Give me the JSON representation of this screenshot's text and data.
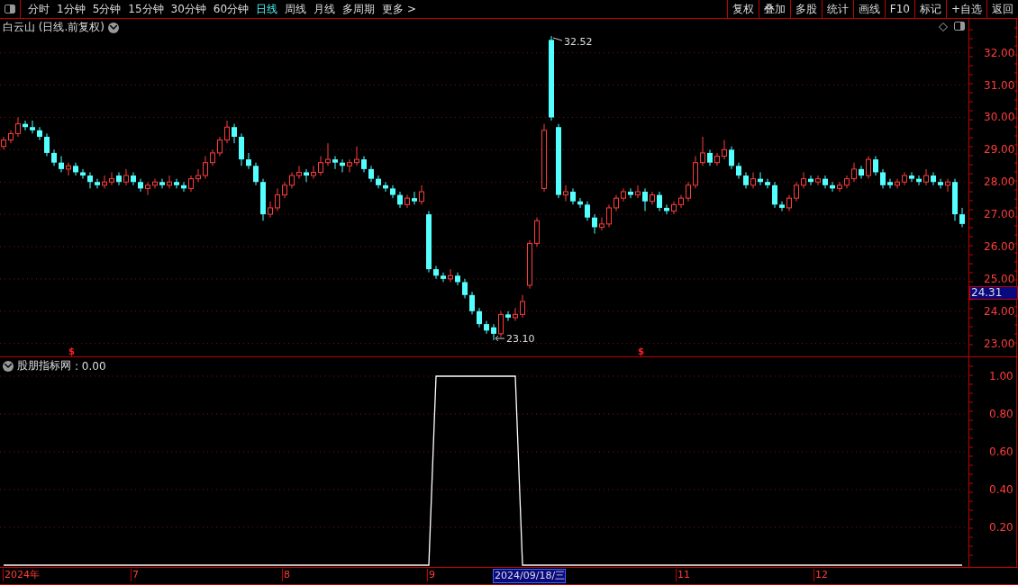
{
  "toolbar": {
    "periods": [
      {
        "label": "分时",
        "selected": false
      },
      {
        "label": "1分钟",
        "selected": false
      },
      {
        "label": "5分钟",
        "selected": false
      },
      {
        "label": "15分钟",
        "selected": false
      },
      {
        "label": "30分钟",
        "selected": false
      },
      {
        "label": "60分钟",
        "selected": false
      },
      {
        "label": "日线",
        "selected": true
      },
      {
        "label": "周线",
        "selected": false
      },
      {
        "label": "月线",
        "selected": false
      },
      {
        "label": "多周期",
        "selected": false
      },
      {
        "label": "更多 >",
        "selected": false
      }
    ],
    "actions": [
      "复权",
      "叠加",
      "多股",
      "统计",
      "画线",
      "F10",
      "标记",
      "+自选",
      "返回"
    ]
  },
  "main_chart": {
    "title": "白云山 (日线.前复权)",
    "current_price": "24.31",
    "markers": [
      "$",
      "$"
    ],
    "chart_data": {
      "type": "candlestick",
      "ylim": [
        22.6,
        33.05
      ],
      "yticks": [
        {
          "value": 32,
          "label": "32.00"
        },
        {
          "value": 31,
          "label": "31.00"
        },
        {
          "value": 30,
          "label": "30.00"
        },
        {
          "value": 29,
          "label": "29.00"
        },
        {
          "value": 28,
          "label": "28.00"
        },
        {
          "value": 27,
          "label": "27.00"
        },
        {
          "value": 26,
          "label": "26.00"
        },
        {
          "value": 25,
          "label": "25.00"
        },
        {
          "value": 24,
          "label": "24.00"
        },
        {
          "value": 23,
          "label": "23.00"
        }
      ],
      "grid": true,
      "annotations": [
        "32.52",
        "23.10"
      ],
      "ohlc": [
        [
          29.1,
          29.4,
          29.0,
          29.3
        ],
        [
          29.3,
          29.6,
          29.2,
          29.5
        ],
        [
          29.5,
          30.0,
          29.4,
          29.8
        ],
        [
          29.8,
          29.9,
          29.6,
          29.7
        ],
        [
          29.7,
          29.9,
          29.5,
          29.6
        ],
        [
          29.6,
          29.7,
          29.3,
          29.4
        ],
        [
          29.4,
          29.5,
          28.8,
          28.9
        ],
        [
          28.9,
          29.0,
          28.5,
          28.6
        ],
        [
          28.6,
          28.8,
          28.3,
          28.4
        ],
        [
          28.4,
          28.6,
          28.2,
          28.5
        ],
        [
          28.5,
          28.6,
          28.2,
          28.3
        ],
        [
          28.3,
          28.4,
          28.1,
          28.2
        ],
        [
          28.2,
          28.3,
          27.8,
          28.0
        ],
        [
          28.0,
          28.1,
          27.8,
          27.9
        ],
        [
          27.9,
          28.2,
          27.8,
          28.0
        ],
        [
          28.0,
          28.3,
          27.9,
          28.1
        ],
        [
          28.2,
          28.3,
          27.9,
          28.0
        ],
        [
          28.0,
          28.4,
          27.9,
          28.2
        ],
        [
          28.2,
          28.3,
          27.9,
          28.0
        ],
        [
          28.0,
          28.1,
          27.7,
          27.8
        ],
        [
          27.8,
          28.0,
          27.6,
          27.9
        ],
        [
          27.9,
          28.1,
          27.8,
          28.0
        ],
        [
          28.0,
          28.1,
          27.8,
          27.9
        ],
        [
          27.9,
          28.2,
          27.8,
          28.0
        ],
        [
          28.0,
          28.1,
          27.8,
          27.9
        ],
        [
          27.9,
          28.0,
          27.7,
          27.8
        ],
        [
          27.8,
          28.2,
          27.7,
          28.1
        ],
        [
          28.1,
          28.4,
          28.0,
          28.2
        ],
        [
          28.2,
          28.8,
          28.1,
          28.6
        ],
        [
          28.6,
          29.0,
          28.5,
          28.9
        ],
        [
          28.9,
          29.4,
          28.8,
          29.3
        ],
        [
          29.3,
          29.9,
          29.2,
          29.7
        ],
        [
          29.7,
          29.8,
          29.2,
          29.4
        ],
        [
          29.4,
          29.5,
          28.5,
          28.7
        ],
        [
          28.7,
          28.9,
          28.4,
          28.5
        ],
        [
          28.5,
          28.6,
          27.9,
          28.0
        ],
        [
          28.0,
          28.1,
          26.8,
          27.0
        ],
        [
          27.0,
          27.4,
          26.9,
          27.2
        ],
        [
          27.2,
          27.8,
          27.1,
          27.6
        ],
        [
          27.6,
          28.0,
          27.5,
          27.9
        ],
        [
          27.9,
          28.3,
          27.8,
          28.2
        ],
        [
          28.2,
          28.5,
          28.1,
          28.3
        ],
        [
          28.3,
          28.4,
          28.0,
          28.2
        ],
        [
          28.2,
          28.5,
          28.1,
          28.3
        ],
        [
          28.3,
          28.8,
          28.2,
          28.6
        ],
        [
          28.6,
          29.2,
          28.5,
          28.7
        ],
        [
          28.7,
          28.8,
          28.4,
          28.6
        ],
        [
          28.6,
          28.7,
          28.3,
          28.5
        ],
        [
          28.5,
          28.7,
          28.3,
          28.6
        ],
        [
          28.6,
          29.1,
          28.5,
          28.7
        ],
        [
          28.7,
          28.8,
          28.3,
          28.4
        ],
        [
          28.4,
          28.5,
          28.0,
          28.1
        ],
        [
          28.1,
          28.2,
          27.8,
          27.9
        ],
        [
          27.9,
          28.0,
          27.7,
          27.8
        ],
        [
          27.8,
          27.9,
          27.5,
          27.6
        ],
        [
          27.6,
          27.7,
          27.2,
          27.3
        ],
        [
          27.3,
          27.6,
          27.2,
          27.5
        ],
        [
          27.5,
          27.7,
          27.3,
          27.4
        ],
        [
          27.4,
          27.9,
          27.3,
          27.7
        ],
        [
          27.0,
          27.1,
          25.2,
          25.3
        ],
        [
          25.3,
          25.4,
          25.0,
          25.1
        ],
        [
          25.1,
          25.2,
          24.9,
          25.0
        ],
        [
          25.0,
          25.3,
          24.9,
          25.1
        ],
        [
          25.1,
          25.2,
          24.8,
          24.9
        ],
        [
          24.9,
          25.0,
          24.4,
          24.5
        ],
        [
          24.5,
          24.6,
          23.9,
          24.0
        ],
        [
          24.0,
          24.1,
          23.5,
          23.6
        ],
        [
          23.6,
          23.7,
          23.3,
          23.4
        ],
        [
          23.5,
          23.6,
          23.1,
          23.3
        ],
        [
          23.3,
          24.0,
          23.2,
          23.9
        ],
        [
          23.9,
          24.0,
          23.7,
          23.8
        ],
        [
          23.8,
          24.1,
          23.7,
          23.9
        ],
        [
          23.9,
          24.5,
          23.8,
          24.3
        ],
        [
          24.8,
          26.2,
          24.7,
          26.1
        ],
        [
          26.1,
          26.9,
          26.0,
          26.8
        ],
        [
          27.8,
          29.8,
          27.7,
          29.6
        ],
        [
          32.4,
          32.52,
          29.9,
          30.0
        ],
        [
          29.7,
          29.8,
          27.5,
          27.6
        ],
        [
          27.6,
          27.9,
          27.4,
          27.7
        ],
        [
          27.7,
          27.8,
          27.3,
          27.4
        ],
        [
          27.4,
          27.5,
          27.2,
          27.3
        ],
        [
          27.3,
          27.4,
          26.8,
          26.9
        ],
        [
          26.9,
          27.0,
          26.4,
          26.6
        ],
        [
          26.6,
          26.9,
          26.5,
          26.7
        ],
        [
          26.7,
          27.3,
          26.6,
          27.2
        ],
        [
          27.2,
          27.6,
          27.1,
          27.5
        ],
        [
          27.5,
          27.8,
          27.4,
          27.7
        ],
        [
          27.7,
          27.8,
          27.5,
          27.6
        ],
        [
          27.6,
          27.9,
          27.5,
          27.7
        ],
        [
          27.7,
          27.8,
          27.1,
          27.4
        ],
        [
          27.4,
          27.7,
          27.3,
          27.6
        ],
        [
          27.6,
          27.7,
          27.1,
          27.2
        ],
        [
          27.2,
          27.3,
          27.0,
          27.1
        ],
        [
          27.1,
          27.4,
          27.0,
          27.3
        ],
        [
          27.3,
          27.6,
          27.2,
          27.5
        ],
        [
          27.5,
          28.0,
          27.4,
          27.9
        ],
        [
          27.9,
          28.8,
          27.8,
          28.6
        ],
        [
          28.6,
          29.4,
          28.5,
          28.9
        ],
        [
          28.9,
          29.0,
          28.5,
          28.6
        ],
        [
          28.6,
          28.9,
          28.5,
          28.8
        ],
        [
          28.8,
          29.3,
          28.7,
          29.0
        ],
        [
          29.0,
          29.1,
          28.4,
          28.5
        ],
        [
          28.5,
          28.6,
          28.1,
          28.2
        ],
        [
          28.2,
          28.3,
          27.8,
          27.9
        ],
        [
          27.9,
          28.3,
          27.8,
          28.1
        ],
        [
          28.1,
          28.3,
          27.9,
          28.0
        ],
        [
          28.0,
          28.1,
          27.8,
          27.9
        ],
        [
          27.9,
          28.0,
          27.2,
          27.3
        ],
        [
          27.3,
          27.4,
          27.1,
          27.2
        ],
        [
          27.2,
          27.6,
          27.1,
          27.5
        ],
        [
          27.5,
          28.0,
          27.4,
          27.9
        ],
        [
          27.9,
          28.3,
          27.8,
          28.1
        ],
        [
          28.1,
          28.2,
          27.9,
          28.0
        ],
        [
          28.0,
          28.2,
          27.9,
          28.1
        ],
        [
          28.1,
          28.2,
          27.8,
          27.9
        ],
        [
          27.9,
          28.0,
          27.7,
          27.8
        ],
        [
          27.8,
          28.0,
          27.7,
          27.9
        ],
        [
          27.9,
          28.2,
          27.8,
          28.1
        ],
        [
          28.1,
          28.6,
          28.0,
          28.4
        ],
        [
          28.4,
          28.5,
          28.1,
          28.2
        ],
        [
          28.2,
          28.8,
          28.1,
          28.7
        ],
        [
          28.7,
          28.8,
          28.2,
          28.3
        ],
        [
          28.3,
          28.4,
          27.8,
          27.9
        ],
        [
          28.0,
          28.1,
          27.8,
          27.9
        ],
        [
          27.9,
          28.1,
          27.8,
          28.0
        ],
        [
          28.0,
          28.3,
          27.9,
          28.2
        ],
        [
          28.2,
          28.3,
          28.0,
          28.1
        ],
        [
          28.1,
          28.2,
          27.9,
          28.0
        ],
        [
          28.0,
          28.4,
          27.9,
          28.2
        ],
        [
          28.2,
          28.3,
          27.9,
          28.0
        ],
        [
          28.0,
          28.1,
          27.8,
          27.9
        ],
        [
          27.9,
          28.1,
          27.7,
          28.0
        ],
        [
          28.0,
          28.1,
          26.8,
          27.0
        ],
        [
          27.0,
          27.2,
          26.6,
          26.7
        ]
      ]
    }
  },
  "indicator": {
    "legend_value": ": 0.00",
    "chart_data": {
      "type": "line",
      "ylim": [
        0,
        1.1
      ],
      "grid": true,
      "yticks": [
        {
          "value": 0.2,
          "label": "0.20"
        },
        {
          "value": 0.4,
          "label": "0.40"
        },
        {
          "value": 0.6,
          "label": "0.60"
        },
        {
          "value": 0.8,
          "label": "0.80"
        },
        {
          "value": 1.0,
          "label": "1.00"
        }
      ],
      "series": [
        {
          "name": "股朋指标网",
          "color": "#ffffff",
          "values": [
            0,
            0,
            0,
            0,
            0,
            0,
            0,
            0,
            0,
            0,
            0,
            0,
            0,
            0,
            0,
            0,
            0,
            0,
            0,
            0,
            0,
            0,
            0,
            0,
            0,
            0,
            0,
            0,
            0,
            0,
            0,
            0,
            0,
            0,
            0,
            0,
            0,
            0,
            0,
            0,
            0,
            0,
            0,
            0,
            0,
            0,
            0,
            0,
            0,
            0,
            0,
            0,
            0,
            0,
            0,
            0,
            0,
            0,
            0,
            0,
            1,
            1,
            1,
            1,
            1,
            1,
            1,
            1,
            1,
            1,
            1,
            1,
            0,
            0,
            0,
            0,
            0,
            0,
            0,
            0,
            0,
            0,
            0,
            0,
            0,
            0,
            0,
            0,
            0,
            0,
            0,
            0,
            0,
            0,
            0,
            0,
            0,
            0,
            0,
            0,
            0,
            0,
            0,
            0,
            0,
            0,
            0,
            0,
            0,
            0,
            0,
            0,
            0,
            0,
            0,
            0,
            0,
            0,
            0,
            0,
            0,
            0,
            0,
            0,
            0,
            0,
            0,
            0,
            0,
            0,
            0,
            0,
            0,
            0
          ]
        }
      ]
    }
  },
  "time_axis": {
    "labels": [
      {
        "text": "2024年",
        "selected": false
      },
      {
        "text": "7",
        "selected": false
      },
      {
        "text": "8",
        "selected": false
      },
      {
        "text": "9",
        "selected": false
      },
      {
        "text": "2024/09/18/三",
        "selected": true
      },
      {
        "text": "11",
        "selected": false
      },
      {
        "text": "12",
        "selected": false
      }
    ]
  }
}
